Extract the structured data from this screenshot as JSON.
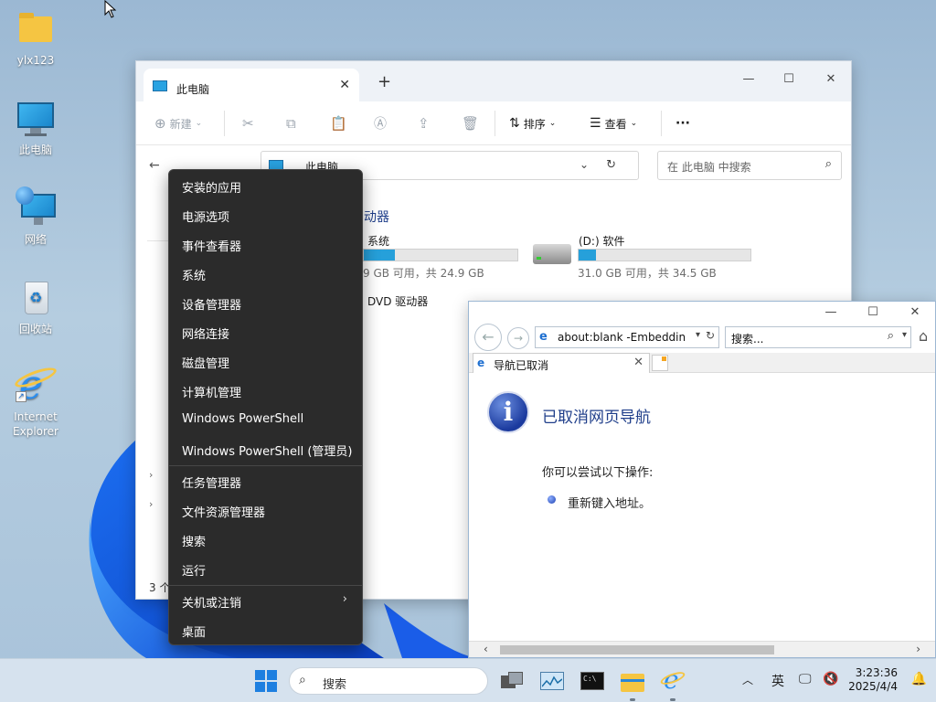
{
  "desktop": {
    "icons": [
      {
        "label": "ylx123",
        "icon": "folder-icon"
      },
      {
        "label": "此电脑",
        "icon": "computer-icon"
      },
      {
        "label": "网络",
        "icon": "network-icon"
      },
      {
        "label": "回收站",
        "icon": "recycle-bin-icon"
      },
      {
        "label": "Internet Explorer",
        "icon": "ie-icon"
      }
    ]
  },
  "explorer": {
    "tab_title": "此电脑",
    "new_tab": "+",
    "toolbar": {
      "new_label": "新建",
      "sort_label": "排序",
      "view_label": "查看",
      "more": "···"
    },
    "address": "此电脑",
    "search_placeholder": "在 此电脑 中搜索",
    "section_partial": "动器",
    "drives": [
      {
        "name": "系统",
        "info": "9 GB 可用，共 24.9 GB",
        "used_fraction": 0.2
      },
      {
        "name": "(D:) 软件",
        "info": "31.0 GB 可用，共 34.5 GB",
        "used_fraction": 0.1
      }
    ],
    "dvd_label": "DVD 驱动器",
    "status": "3 个"
  },
  "ie": {
    "address": "about:blank -Embeddin",
    "search": "搜索...",
    "tab_title": "导航已取消",
    "heading": "已取消网页导航",
    "paragraph": "你可以尝试以下操作:",
    "bullet": "重新键入地址。"
  },
  "context_menu": {
    "items": [
      "安装的应用",
      "电源选项",
      "事件查看器",
      "系统",
      "设备管理器",
      "网络连接",
      "磁盘管理",
      "计算机管理",
      "Windows PowerShell",
      "Windows PowerShell (管理员)",
      "任务管理器",
      "文件资源管理器",
      "搜索",
      "运行",
      "关机或注销",
      "桌面"
    ]
  },
  "taskbar": {
    "search_label": "搜索",
    "ime": "英",
    "time": "3:23:36",
    "date": "2025/4/4"
  },
  "colors": {
    "accent": "#26a0da",
    "menu_bg": "#2b2b2b",
    "ie_heading": "#1f3e8a"
  }
}
